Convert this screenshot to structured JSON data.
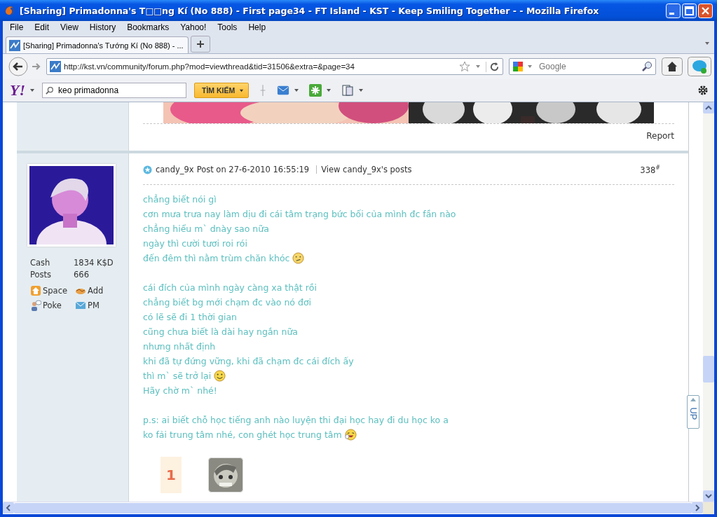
{
  "window": {
    "title": "[Sharing] Primadonna's T□□ng Kí (No 888) - First page34 - FT Island - KST - Keep Smiling Together - - Mozilla Firefox"
  },
  "menu": [
    {
      "label": "File"
    },
    {
      "label": "Edit"
    },
    {
      "label": "View"
    },
    {
      "label": "History"
    },
    {
      "label": "Bookmarks"
    },
    {
      "label": "Yahoo!"
    },
    {
      "label": "Tools"
    },
    {
      "label": "Help"
    }
  ],
  "tabs": [
    {
      "label": "[Sharing] Primadonna's Tướng Kí (No 888) - ...",
      "selected": true
    }
  ],
  "address": {
    "value": "http://kst.vn/community/forum.php?mod=viewthread&tid=31506&extra=&page=34"
  },
  "search": {
    "placeholder": "Google"
  },
  "yahoo_toolbar": {
    "logo": "Y!",
    "search_value": "keo primadonna",
    "search_button": "TÌM KIẾM"
  },
  "previous_post": {
    "action": "Report"
  },
  "post": {
    "author": "candy_9x",
    "posted": "Post on 27-6-2010 16:55:19",
    "view_link": "View candy_9x's posts",
    "number": "338$^{#}$",
    "stats": [
      {
        "label": "Cash",
        "value": "1834 K$D"
      },
      {
        "label": "Posts",
        "value": "666"
      }
    ],
    "links": [
      {
        "kind": "space",
        "label": "Space"
      },
      {
        "kind": "add",
        "label": "Add"
      },
      {
        "kind": "poke",
        "label": "Poke"
      },
      {
        "kind": "pm",
        "label": "PM"
      }
    ],
    "paragraphs": [
      {
        "lines": [
          {
            "text": "chẳng biết nói gì",
            "kind": "plain"
          },
          {
            "text": "cơn mưa trưa nay làm dịu đi cái tâm trạng bức bối của mình đc fần nào",
            "kind": "plain"
          },
          {
            "text": "chẳng hiểu m` dnày sao nữa",
            "kind": "plain"
          },
          {
            "text": "ngày thì cười tươi roi rói",
            "kind": "plain"
          },
          {
            "text": "đến đêm thì nằm trùm chăn khóc",
            "kind": "confused"
          }
        ]
      },
      {
        "lines": [
          {
            "text": "cái đích của mình ngày càng xa thật rồi",
            "kind": "plain"
          },
          {
            "text": "chẳng biết bg mới chạm đc vào nó đơi",
            "kind": "plain"
          },
          {
            "text": "có lẽ sẽ đi 1 thời gian",
            "kind": "plain"
          },
          {
            "text": "cũng chưa biết là dài hay ngắn nữa",
            "kind": "plain"
          },
          {
            "text": "nhưng nhất định",
            "kind": "plain"
          },
          {
            "text": "khi đã tự đứng vững, khi đã chạm đc cái đích ấy",
            "kind": "plain"
          },
          {
            "text": "thì m` sẽ trở lại",
            "kind": "smile"
          },
          {
            "text": "Hãy chờ m` nhé!",
            "kind": "plain"
          }
        ]
      },
      {
        "lines": [
          {
            "text": "p.s: ai biết chỗ học tiếng anh nào luyện thi đại học hay đi du học ko a",
            "kind": "plain"
          },
          {
            "text": "ko fải trung tâm nhé, con ghét học trung tâm",
            "kind": "laugh"
          }
        ]
      }
    ],
    "rating": "1"
  },
  "up_button": "UP"
}
